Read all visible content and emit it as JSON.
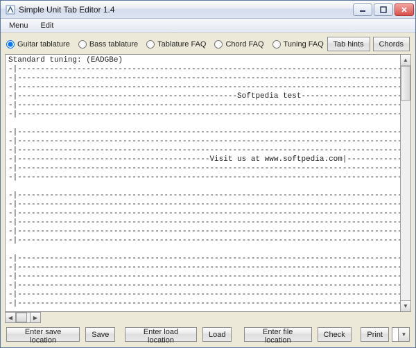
{
  "window": {
    "title": "Simple Unit Tab Editor  1.4",
    "icon": "tab-editor-icon"
  },
  "menu": {
    "items": [
      "Menu",
      "Edit"
    ]
  },
  "radios": [
    {
      "label": "Guitar tablature",
      "checked": true
    },
    {
      "label": "Bass tablature",
      "checked": false
    },
    {
      "label": "Tablature FAQ",
      "checked": false
    },
    {
      "label": "Chord FAQ",
      "checked": false
    },
    {
      "label": "Tuning FAQ",
      "checked": false
    }
  ],
  "toolbar": {
    "tab_hints": "Tab hints",
    "chords": "Chords"
  },
  "editor": {
    "content": "Standard tuning: (EADGBe)\n-|------------------------------------------------------------------------------------------------------------------|-\n-|------------------------------------------------------------------------------------------------------------------|-\n-|------------------------------------------------------------------------------------------------------------------|-\n-|------------------------------------------------Softpedia test------------------------------------------------|-\n-|------------------------------------------------------------------------------------------------------------------|-\n-|------------------------------------------------------------------------------------------------------------------|-\n\n-|------------------------------------------------------------------------------------------------------------------|-\n-|------------------------------------------------------------------------------------------------------------------|-\n-|------------------------------------------------------------------------------------------------------------------|-\n-|------------------------------------------Visit us at www.softpedia.com|-----------------------------------------|-\n-|------------------------------------------------------------------------------------------------------------------|-\n-|------------------------------------------------------------------------------------------------------------------|-\n\n-|------------------------------------------------------------------------------------------------------------------|-\n-|------------------------------------------------------------------------------------------------------------------|-\n-|------------------------------------------------------------------------------------------------------------------|-\n-|------------------------------------------------------------------------------------------------------------------|-\n-|------------------------------------------------------------------------------------------------------------------|-\n-|------------------------------------------------------------------------------------------------------------------|-\n\n-|------------------------------------------------------------------------------------------------------------------|-\n-|------------------------------------------------------------------------------------------------------------------|-\n-|------------------------------------------------------------------------------------------------------------------|-\n-|------------------------------------------------------------------------------------------------------------------|-\n-|------------------------------------------------------------------------------------------------------------------|-\n-|------------------------------------------------------------------------------------------------------------------|-\n\n-|------------------------------------------------------------------------------------------------------------------|-"
  },
  "bottom": {
    "enter_save": "Enter save location",
    "save": "Save",
    "enter_load": "Enter load location",
    "load": "Load",
    "enter_file": "Enter file location",
    "check": "Check",
    "print": "Print",
    "combo_value": ""
  }
}
